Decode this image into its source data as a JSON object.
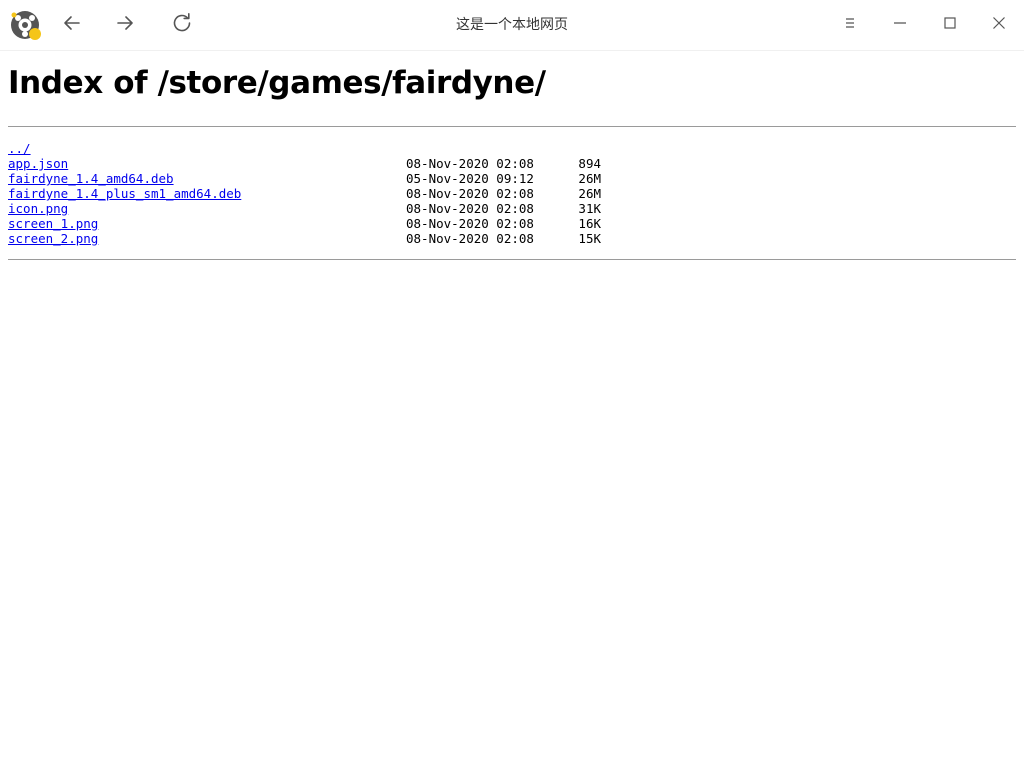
{
  "window": {
    "title": "这是一个本地网页"
  },
  "page": {
    "heading": "Index of /store/games/fairdyne/",
    "parent_link": "../",
    "entries": [
      {
        "name": "app.json",
        "date": "08-Nov-2020 02:08",
        "size": "894"
      },
      {
        "name": "fairdyne_1.4_amd64.deb",
        "date": "05-Nov-2020 09:12",
        "size": "26M"
      },
      {
        "name": "fairdyne_1.4_plus_sm1_amd64.deb",
        "date": "08-Nov-2020 02:08",
        "size": "26M"
      },
      {
        "name": "icon.png",
        "date": "08-Nov-2020 02:08",
        "size": "31K"
      },
      {
        "name": "screen_1.png",
        "date": "08-Nov-2020 02:08",
        "size": "16K"
      },
      {
        "name": "screen_2.png",
        "date": "08-Nov-2020 02:08",
        "size": "15K"
      }
    ]
  },
  "icons": {
    "logo": "browser-logo-icon",
    "back": "arrow-left-icon",
    "forward": "arrow-right-icon",
    "reload": "reload-icon",
    "menu": "hamburger-menu-icon",
    "minimize": "minimize-icon",
    "maximize": "maximize-icon",
    "close": "close-icon"
  },
  "colors": {
    "link": "#0000ee",
    "logo_dark": "#555555",
    "logo_accent": "#f5c518"
  }
}
